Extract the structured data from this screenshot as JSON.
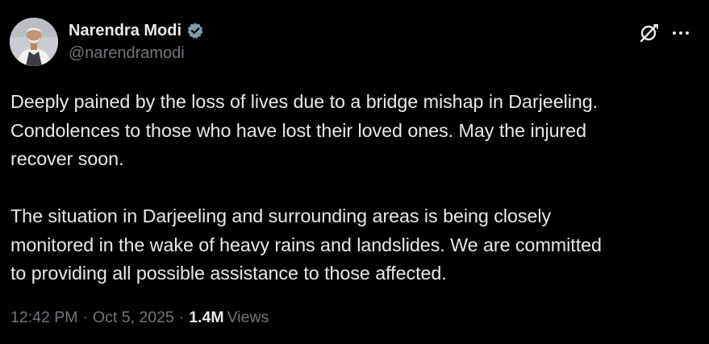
{
  "author": {
    "display_name": "Narendra Modi",
    "handle": "@narendramodi",
    "verified": true,
    "verified_color": "#829aab"
  },
  "icons": {
    "verified": "verified-badge-icon",
    "grok": "grok-icon",
    "more": "more-options-icon"
  },
  "tweet": {
    "paragraphs": [
      "Deeply pained by the loss of lives due to a bridge mishap in Darjeeling.\nCondolences to those who have lost their loved ones. May the injured\nrecover soon.",
      "The situation in Darjeeling and surrounding areas is being closely\nmonitored in the wake of heavy rains and landslides. We are committed\nto providing all possible assistance to those affected."
    ]
  },
  "meta": {
    "time": "12:42 PM",
    "separator": "·",
    "date": "Oct 5, 2025",
    "views_count": "1.4M",
    "views_label": "Views"
  },
  "colors": {
    "background": "#000000",
    "text_primary": "#e7e9ea",
    "text_secondary": "#71767b"
  }
}
